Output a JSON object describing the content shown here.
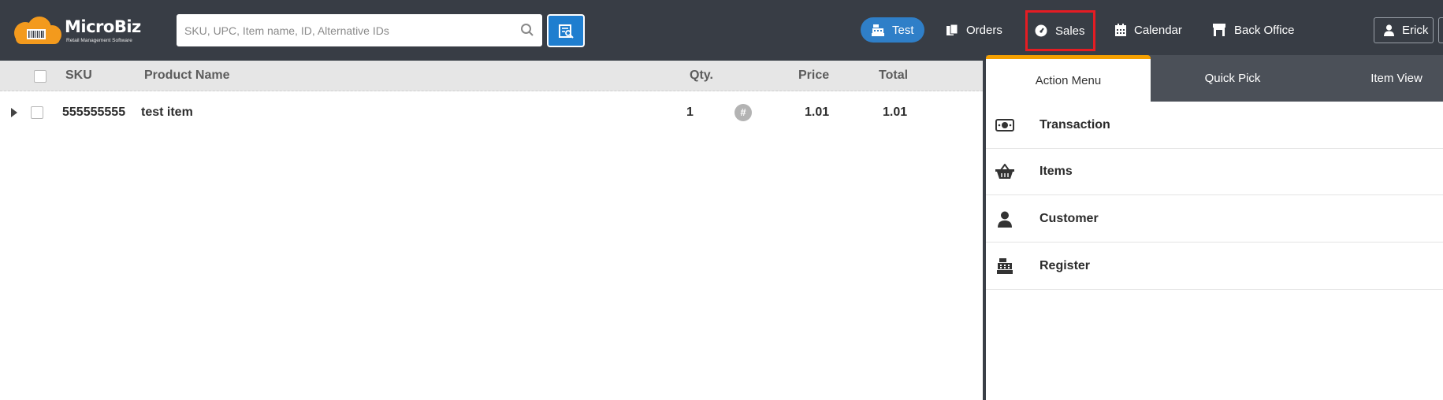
{
  "header": {
    "logo_text": "MicroBiz",
    "logo_subtitle": "Retail Management Software",
    "search_placeholder": "SKU, UPC, Item name, ID, Alternative IDs",
    "nav": {
      "test": "Test",
      "orders": "Orders",
      "sales": "Sales",
      "calendar": "Calendar",
      "back_office": "Back Office"
    },
    "user_name": "Erick"
  },
  "table": {
    "columns": {
      "sku": "SKU",
      "product_name": "Product Name",
      "qty": "Qty.",
      "price": "Price",
      "total": "Total"
    },
    "rows": [
      {
        "sku": "555555555",
        "product_name": "test item",
        "qty": "1",
        "price": "1.01",
        "total": "1.01"
      }
    ]
  },
  "panel": {
    "tabs": {
      "action_menu": "Action Menu",
      "quick_pick": "Quick Pick",
      "item_view": "Item View"
    },
    "menu": [
      {
        "label": "Transaction",
        "icon": "money-icon"
      },
      {
        "label": "Items",
        "icon": "basket-icon"
      },
      {
        "label": "Customer",
        "icon": "person-icon"
      },
      {
        "label": "Register",
        "icon": "cash-register-icon"
      }
    ]
  },
  "colors": {
    "header_bg": "#383d45",
    "accent_blue": "#2f7fc8",
    "tab_accent": "#f5a000",
    "highlight_red": "#e51c23"
  }
}
